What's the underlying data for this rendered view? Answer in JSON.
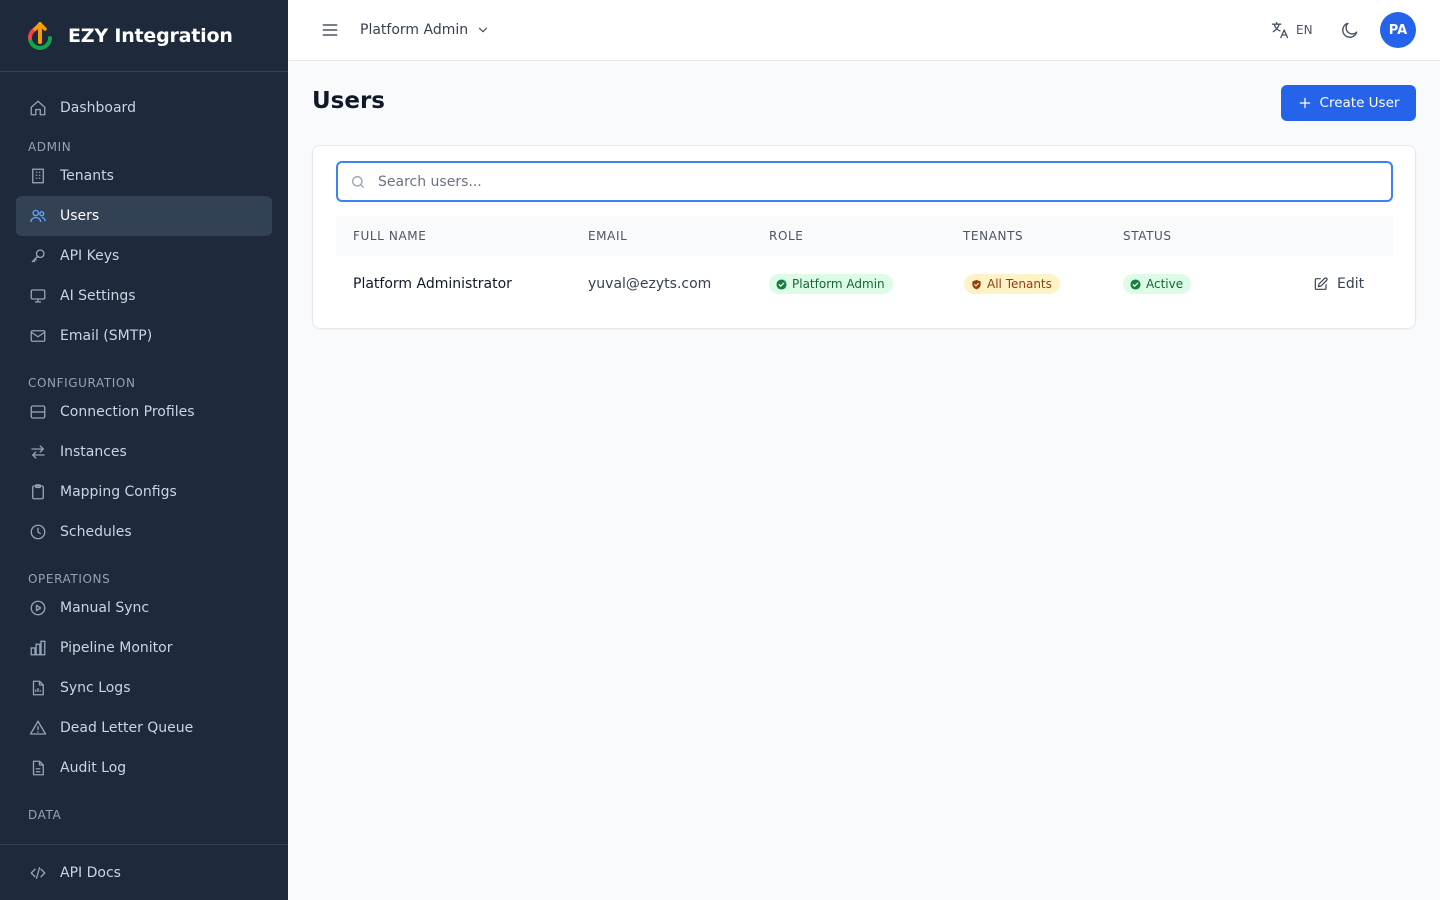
{
  "brand": {
    "name": "EZY Integration"
  },
  "sidebar": {
    "dashboard": "Dashboard",
    "sections": {
      "admin": "ADMIN",
      "configuration": "CONFIGURATION",
      "operations": "OPERATIONS",
      "data": "DATA"
    },
    "admin_items": [
      "Tenants",
      "Users",
      "API Keys",
      "AI Settings",
      "Email (SMTP)"
    ],
    "config_items": [
      "Connection Profiles",
      "Instances",
      "Mapping Configs",
      "Schedules"
    ],
    "ops_items": [
      "Manual Sync",
      "Pipeline Monitor",
      "Sync Logs",
      "Dead Letter Queue",
      "Audit Log"
    ],
    "footer_item": "API Docs",
    "active": "Users"
  },
  "header": {
    "tenant_selected": "Platform Admin",
    "language": "EN",
    "avatar_initials": "PA"
  },
  "page": {
    "title": "Users",
    "create_button": "Create User",
    "search_placeholder": "Search users..."
  },
  "table": {
    "columns": [
      "FULL NAME",
      "EMAIL",
      "ROLE",
      "TENANTS",
      "STATUS"
    ],
    "rows": [
      {
        "full_name": "Platform Administrator",
        "email": "yuval@ezyts.com",
        "role": "Platform Admin",
        "tenants": "All Tenants",
        "status": "Active",
        "action": "Edit"
      }
    ]
  },
  "colors": {
    "sidebar_bg": "#1e293b",
    "accent": "#2563eb",
    "badge_green_bg": "#dcfce7",
    "badge_green_text": "#166534",
    "badge_yellow_bg": "#fef3c7",
    "badge_yellow_text": "#92400e"
  },
  "icons": {
    "dashboard": "home-icon",
    "tenants": "building-icon",
    "users": "users-icon",
    "api_keys": "key-icon",
    "ai_settings": "monitor-icon",
    "email": "mail-icon",
    "connection_profiles": "server-icon",
    "instances": "arrows-exchange-icon",
    "mapping_configs": "clipboard-icon",
    "schedules": "clock-icon",
    "manual_sync": "play-circle-icon",
    "pipeline_monitor": "bar-chart-icon",
    "sync_logs": "file-chart-icon",
    "dead_letter_queue": "warning-triangle-icon",
    "audit_log": "file-text-icon",
    "api_docs": "code-icon"
  }
}
